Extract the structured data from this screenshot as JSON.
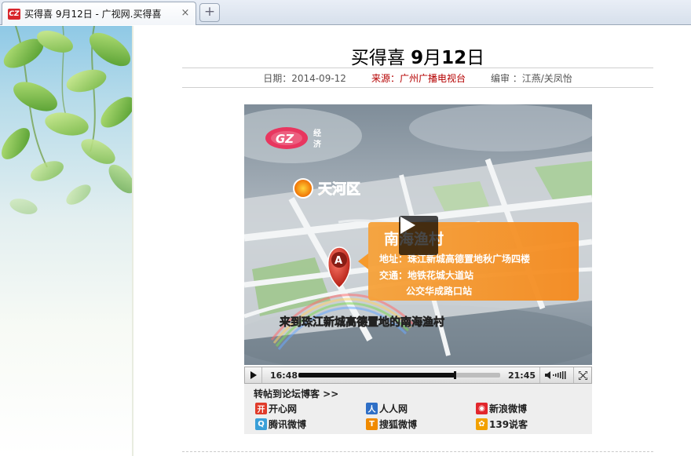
{
  "browser": {
    "tab_title": "买得喜 9月12日 - 广视网.买得喜",
    "favicon_text": "CZ",
    "tab_close_glyph": "×",
    "new_tab_glyph": "+"
  },
  "article": {
    "title_prefix": "买得喜 ",
    "title_month_num": "9",
    "title_month_char": "月",
    "title_day_num": "12",
    "title_day_char": "日",
    "date": "日期：2014-09-12",
    "source": "来源：广州广播电视台",
    "editor": "编审 ：江燕/关凤怡"
  },
  "video": {
    "channel_logo": "GZ",
    "channel_name_top": "经",
    "channel_name_bottom": "济",
    "district_label": "天河区",
    "marker_letter": "A",
    "place_name": "南海渔村",
    "address_line": "地址：珠江新城高德置地秋广场四楼",
    "transport_line1": "交通：地铁花城大道站",
    "transport_line2": "公交华成路口站",
    "subtitle": "来到珠江新城高德置地的南海渔村",
    "current_time": "16:48",
    "total_time": "21:45",
    "progress": 0.7724
  },
  "share": {
    "title": "转帖到论坛博客 >>",
    "items": [
      {
        "label": "开心网",
        "icon": "开",
        "color": "#e03b2a"
      },
      {
        "label": "人人网",
        "icon": "人",
        "color": "#2f6fc6"
      },
      {
        "label": "新浪微博",
        "icon": "◉",
        "color": "#e2262c"
      },
      {
        "label": "腾讯微博",
        "icon": "Q",
        "color": "#3a9fd8"
      },
      {
        "label": "搜狐微博",
        "icon": "T",
        "color": "#f08a00"
      },
      {
        "label": "139说客",
        "icon": "✿",
        "color": "#f2a100"
      }
    ]
  }
}
